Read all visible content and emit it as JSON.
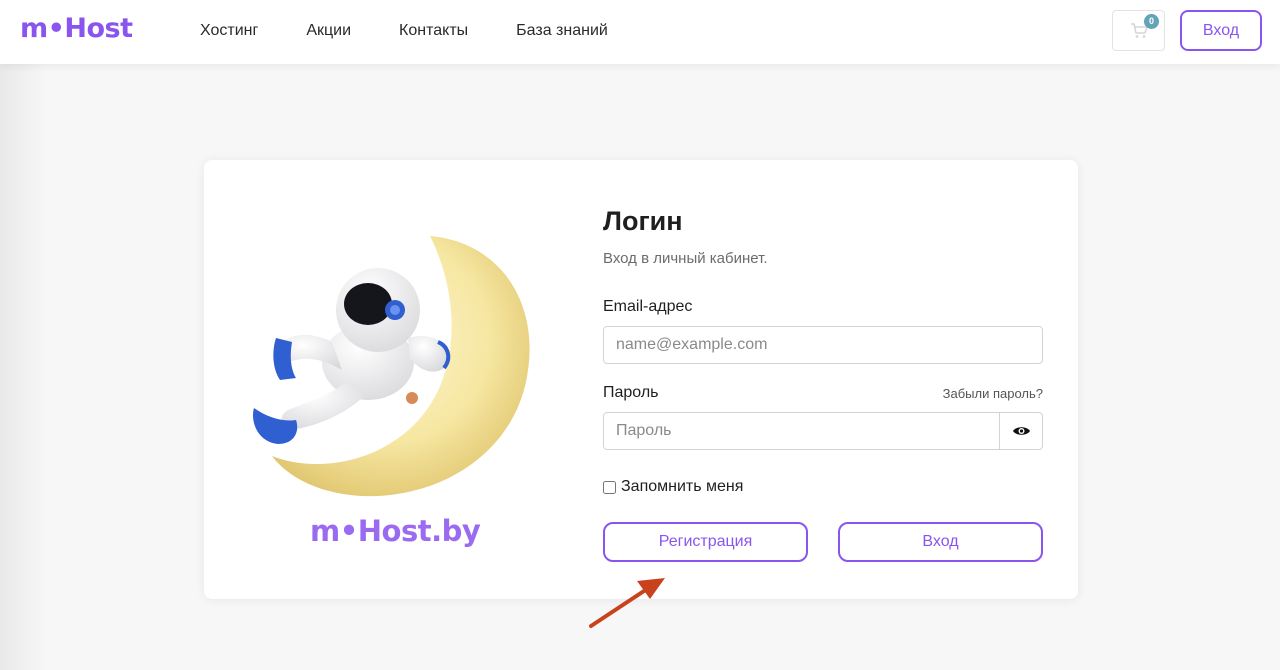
{
  "header": {
    "logo": "m•Host",
    "nav": [
      "Хостинг",
      "Акции",
      "Контакты",
      "База знаний"
    ],
    "cart_count": "0",
    "login_button": "Вход"
  },
  "login_card": {
    "brand": "m•Host.by",
    "title": "Логин",
    "subtitle": "Вход в личный кабинет.",
    "email_label": "Email-адрес",
    "email_placeholder": "name@example.com",
    "email_value": "",
    "password_label": "Пароль",
    "forgot_link": "Забыли пароль?",
    "password_placeholder": "Пароль",
    "password_value": "",
    "remember_label": "Запомнить меня",
    "remember_checked": false,
    "register_button": "Регистрация",
    "login_button": "Вход"
  },
  "colors": {
    "accent": "#8a55ee",
    "cart_badge": "#62a3b8",
    "annotation_arrow": "#c8431d"
  },
  "icons": [
    "cart-icon",
    "eye-icon",
    "astronaut-on-moon-illustration",
    "arrow-annotation"
  ]
}
